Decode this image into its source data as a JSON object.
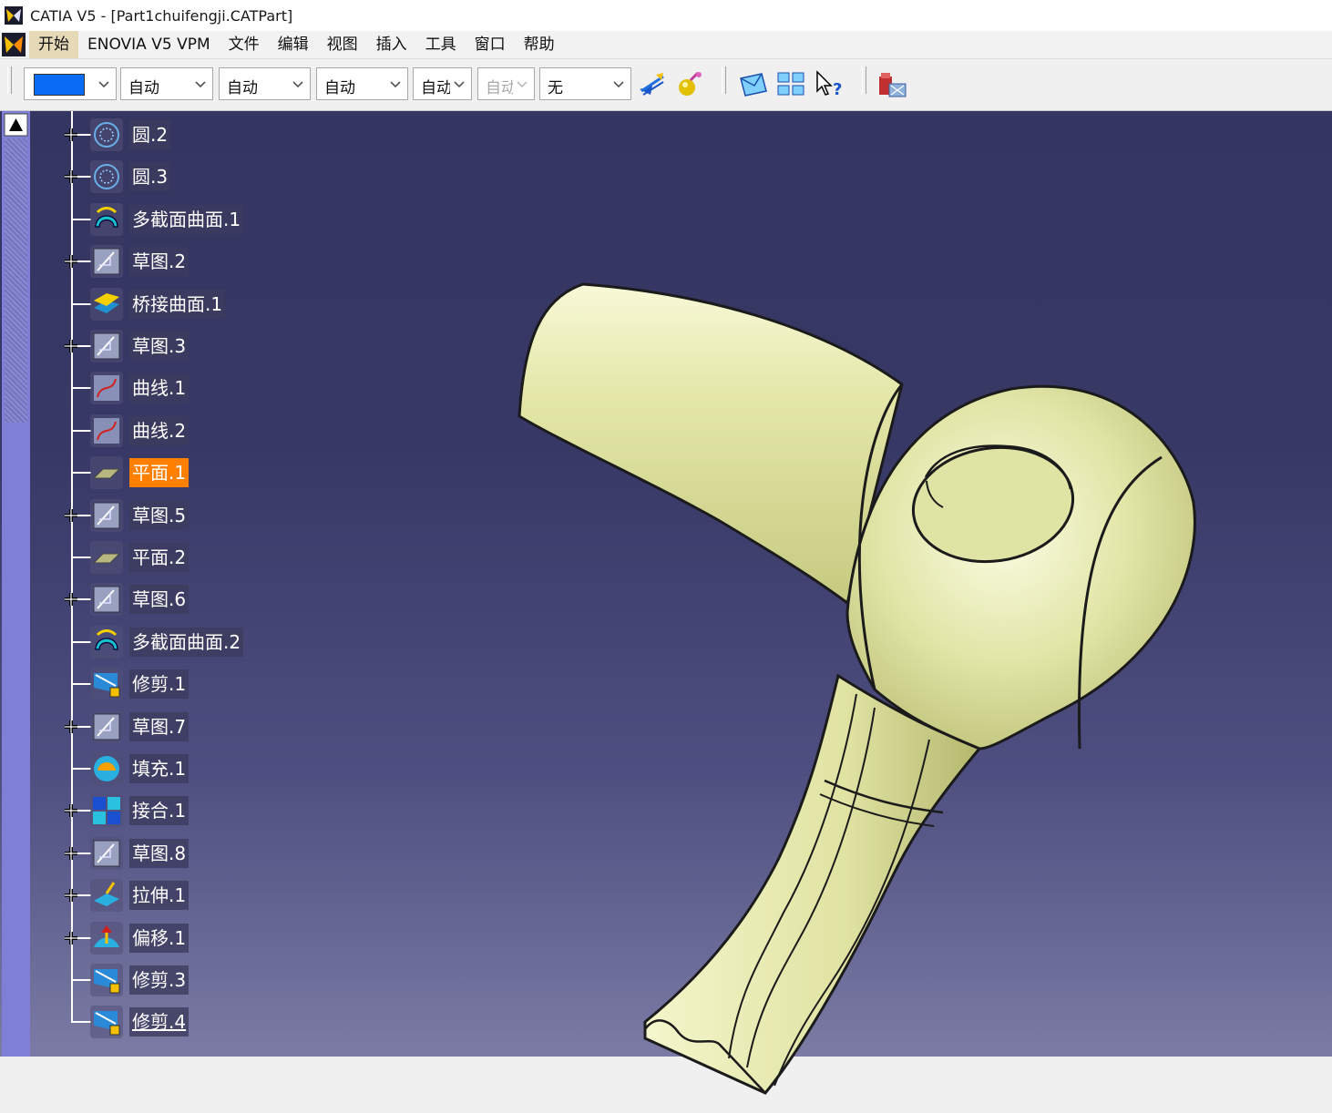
{
  "window": {
    "title": "CATIA V5 - [Part1chuifengji.CATPart]"
  },
  "menu": {
    "items": [
      "开始",
      "ENOVIA V5 VPM",
      "文件",
      "编辑",
      "视图",
      "插入",
      "工具",
      "窗口",
      "帮助"
    ]
  },
  "toolbar": {
    "color_swatch": "#0a6cf5",
    "combos": [
      {
        "value": "自动"
      },
      {
        "value": "自动"
      },
      {
        "value": "自动"
      },
      {
        "value": "自动"
      },
      {
        "value": "自动"
      },
      {
        "value": "无"
      }
    ]
  },
  "tree": {
    "items": [
      {
        "label": "圆.2",
        "icon": "circle-sketch-icon",
        "expandable": true
      },
      {
        "label": "圆.3",
        "icon": "circle-sketch-icon",
        "expandable": true
      },
      {
        "label": "多截面曲面.1",
        "icon": "multi-section-surface-icon",
        "expandable": false
      },
      {
        "label": "草图.2",
        "icon": "sketch-icon",
        "expandable": true
      },
      {
        "label": "桥接曲面.1",
        "icon": "blend-surface-icon",
        "expandable": false
      },
      {
        "label": "草图.3",
        "icon": "sketch-icon",
        "expandable": true
      },
      {
        "label": "曲线.1",
        "icon": "curve-icon",
        "expandable": false
      },
      {
        "label": "曲线.2",
        "icon": "curve-icon",
        "expandable": false
      },
      {
        "label": "平面.1",
        "icon": "plane-icon",
        "expandable": false,
        "selected": true
      },
      {
        "label": "草图.5",
        "icon": "sketch-icon",
        "expandable": true
      },
      {
        "label": "平面.2",
        "icon": "plane-icon",
        "expandable": false
      },
      {
        "label": "草图.6",
        "icon": "sketch-icon",
        "expandable": true
      },
      {
        "label": "多截面曲面.2",
        "icon": "multi-section-surface-icon",
        "expandable": false
      },
      {
        "label": "修剪.1",
        "icon": "trim-icon",
        "expandable": false
      },
      {
        "label": "草图.7",
        "icon": "sketch-icon",
        "expandable": true
      },
      {
        "label": "填充.1",
        "icon": "fill-icon",
        "expandable": false
      },
      {
        "label": "接合.1",
        "icon": "join-icon",
        "expandable": true
      },
      {
        "label": "草图.8",
        "icon": "sketch-icon",
        "expandable": true
      },
      {
        "label": "拉伸.1",
        "icon": "extrude-icon",
        "expandable": true
      },
      {
        "label": "偏移.1",
        "icon": "offset-icon",
        "expandable": true
      },
      {
        "label": "修剪.3",
        "icon": "trim-icon",
        "expandable": false
      },
      {
        "label": "修剪.4",
        "icon": "trim-icon",
        "expandable": false,
        "underline": true
      }
    ]
  },
  "colors": {
    "selection": "#ff8000",
    "model_fill": "#e6e9b0",
    "background_top": "#353561",
    "background_bottom": "#7b7ba5"
  }
}
